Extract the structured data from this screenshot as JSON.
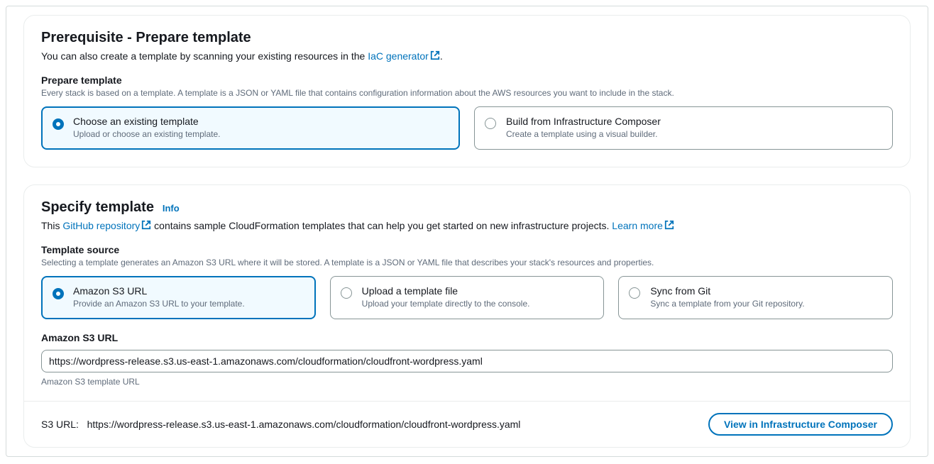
{
  "prereq": {
    "title": "Prerequisite - Prepare template",
    "subtitle_prefix": "You can also create a template by scanning your existing resources in the ",
    "subtitle_link": "IaC generator",
    "subtitle_suffix": ".",
    "section_heading": "Prepare template",
    "section_description": "Every stack is based on a template. A template is a JSON or YAML file that contains configuration information about the AWS resources you want to include in the stack.",
    "options": [
      {
        "title": "Choose an existing template",
        "desc": "Upload or choose an existing template.",
        "selected": true
      },
      {
        "title": "Build from Infrastructure Composer",
        "desc": "Create a template using a visual builder.",
        "selected": false
      }
    ]
  },
  "specify": {
    "title": "Specify template",
    "info_label": "Info",
    "subtitle_prefix": "This ",
    "subtitle_link": "GitHub repository",
    "subtitle_mid": " contains sample CloudFormation templates that can help you get started on new infrastructure projects. ",
    "subtitle_link2": "Learn more",
    "section_heading": "Template source",
    "section_description": "Selecting a template generates an Amazon S3 URL where it will be stored. A template is a JSON or YAML file that describes your stack's resources and properties.",
    "options": [
      {
        "title": "Amazon S3 URL",
        "desc": "Provide an Amazon S3 URL to your template.",
        "selected": true
      },
      {
        "title": "Upload a template file",
        "desc": "Upload your template directly to the console.",
        "selected": false
      },
      {
        "title": "Sync from Git",
        "desc": "Sync a template from your Git repository.",
        "selected": false
      }
    ],
    "s3_input_label": "Amazon S3 URL",
    "s3_input_value": "https://wordpress-release.s3.us-east-1.amazonaws.com/cloudformation/cloudfront-wordpress.yaml",
    "s3_input_helper": "Amazon S3 template URL",
    "footer_label": "S3 URL:",
    "footer_url": "https://wordpress-release.s3.us-east-1.amazonaws.com/cloudformation/cloudfront-wordpress.yaml",
    "footer_button": "View in Infrastructure Composer"
  }
}
